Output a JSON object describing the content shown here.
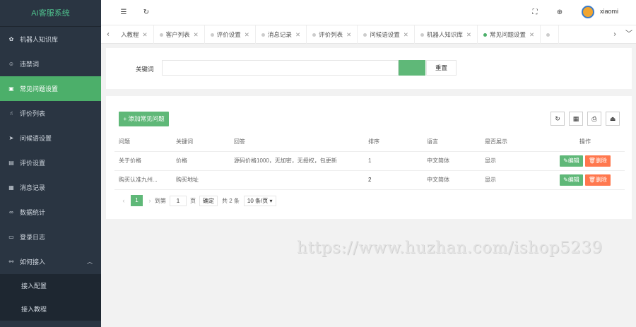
{
  "app": {
    "title": "AI客服系统"
  },
  "sidebar": {
    "items": [
      {
        "label": "机器人知识库",
        "icon": "robot-icon"
      },
      {
        "label": "违禁词",
        "icon": "forbid-icon"
      },
      {
        "label": "常见问题设置",
        "icon": "question-icon",
        "active": true
      },
      {
        "label": "评价列表",
        "icon": "like-icon"
      },
      {
        "label": "问候语设置",
        "icon": "send-icon"
      },
      {
        "label": "评价设置",
        "icon": "list-icon"
      },
      {
        "label": "消息记录",
        "icon": "log-icon"
      },
      {
        "label": "数据统计",
        "icon": "stats-icon"
      },
      {
        "label": "登录日志",
        "icon": "calendar-icon"
      },
      {
        "label": "如何接入",
        "icon": "link-icon",
        "expanded": true
      }
    ],
    "sub_items": [
      {
        "label": "接入配置"
      },
      {
        "label": "接入教程"
      }
    ]
  },
  "header": {
    "menu_icon": "☰",
    "refresh_icon": "↻",
    "fullscreen_icon": "⛶",
    "globe_icon": "⊕",
    "username": "xiaomi"
  },
  "tabs": [
    {
      "label": "入教程"
    },
    {
      "label": "客户列表"
    },
    {
      "label": "评价设置"
    },
    {
      "label": "消息记录"
    },
    {
      "label": "评价列表"
    },
    {
      "label": "问候语设置"
    },
    {
      "label": "机器人知识库"
    },
    {
      "label": "常见问题设置",
      "active": true
    },
    {
      "label": ""
    }
  ],
  "search": {
    "keyword_label": "关键词",
    "keyword_placeholder": "",
    "reset_label": "重置"
  },
  "toolbar": {
    "add_label": "+ 添加常见问题"
  },
  "table": {
    "columns": [
      "问题",
      "关键词",
      "回答",
      "排序",
      "语言",
      "是否展示",
      "操作"
    ],
    "rows": [
      {
        "question": "关于价格",
        "keyword": "价格",
        "answer": "源码价格1000，无加密，无授权，包更新",
        "sort": "1",
        "language": "中文简体",
        "show": "显示"
      },
      {
        "question": "购买认准九州...",
        "keyword": "购买地址",
        "answer": "",
        "sort": "2",
        "language": "中文简体",
        "show": "显示"
      }
    ],
    "edit_label": "✎编辑",
    "delete_label": "🗑删除"
  },
  "pagination": {
    "current": "1",
    "goto_label": "到第",
    "goto_value": "1",
    "page_unit": "页",
    "confirm_label": "确定",
    "total_label": "共 2 条",
    "page_size_label": "10 条/页 ▾"
  },
  "watermark": "https://www.huzhan.com/ishop5239",
  "colors": {
    "sidebar_bg": "#2a3542",
    "accent_green": "#5fb878",
    "active_menu": "#4caf6a",
    "danger": "#ff5722"
  }
}
